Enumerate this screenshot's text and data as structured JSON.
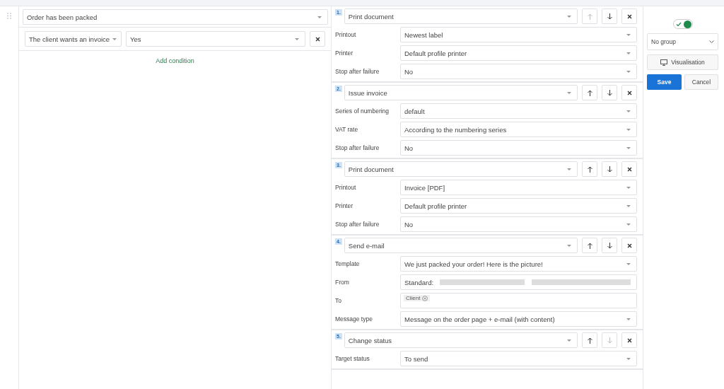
{
  "trigger": {
    "value": "Order has been packed"
  },
  "conditions": [
    {
      "field": "The client wants an invoice",
      "value": "Yes"
    }
  ],
  "add_condition": "Add condition",
  "actions": [
    {
      "number": "1.",
      "type": "Print document",
      "up_disabled": true,
      "down_disabled": false,
      "fields": [
        {
          "label": "Printout",
          "kind": "select",
          "value": "Newest label"
        },
        {
          "label": "Printer",
          "kind": "select",
          "value": "Default profile printer"
        },
        {
          "label": "Stop after failure",
          "kind": "select",
          "value": "No"
        }
      ]
    },
    {
      "number": "2.",
      "type": "Issue invoice",
      "up_disabled": false,
      "down_disabled": false,
      "fields": [
        {
          "label": "Series of numbering",
          "kind": "select",
          "value": "default"
        },
        {
          "label": "VAT rate",
          "kind": "select",
          "value": "According to the numbering series"
        },
        {
          "label": "Stop after failure",
          "kind": "select",
          "value": "No"
        }
      ]
    },
    {
      "number": "3.",
      "type": "Print document",
      "up_disabled": false,
      "down_disabled": false,
      "fields": [
        {
          "label": "Printout",
          "kind": "select",
          "value": "Invoice [PDF]"
        },
        {
          "label": "Printer",
          "kind": "select",
          "value": "Default profile printer"
        },
        {
          "label": "Stop after failure",
          "kind": "select",
          "value": "No"
        }
      ]
    },
    {
      "number": "4.",
      "type": "Send e-mail",
      "up_disabled": false,
      "down_disabled": false,
      "fields": [
        {
          "label": "Template",
          "kind": "select",
          "value": "We just packed your order! Here is the picture!"
        },
        {
          "label": "From",
          "kind": "redacted",
          "value": "Standard:"
        },
        {
          "label": "To",
          "kind": "tags",
          "tags": [
            "Client"
          ]
        },
        {
          "label": "Message type",
          "kind": "select",
          "value": "Message on the order page + e-mail (with content)"
        }
      ]
    },
    {
      "number": "5.",
      "type": "Change status",
      "up_disabled": false,
      "down_disabled": true,
      "fields": [
        {
          "label": "Target status",
          "kind": "select",
          "value": "To send"
        }
      ]
    }
  ],
  "side": {
    "enabled": true,
    "group": "No group",
    "visualisation": "Visualisation",
    "save": "Save",
    "cancel": "Cancel"
  }
}
